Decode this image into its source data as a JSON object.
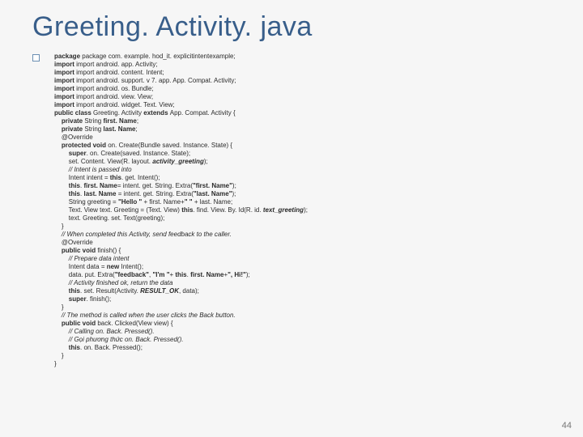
{
  "title": "Greeting. Activity. java",
  "page_number": "44",
  "code": {
    "l01": "package com. example. hod_it. explicitintentexample;",
    "l02": "import android. app. Activity;",
    "l03": "import android. content. Intent;",
    "l04": "import android. support. v 7. app. App. Compat. Activity;",
    "l05": "import android. os. Bundle;",
    "l06": "import android. view. View;",
    "l07": "import android. widget. Text. View;",
    "l08a": "public class ",
    "l08b": "Greeting. Activity ",
    "l08c": "extends ",
    "l08d": "App. Compat. Activity {",
    "l09a": "    private ",
    "l09b": "String ",
    "l09c": "first. Name",
    "l10a": "    private ",
    "l10b": "String ",
    "l10c": "last. Name",
    "l11": "    @Override",
    "l12a": "    protected void ",
    "l12b": "on. Create(Bundle saved. Instance. State) {",
    "l13a": "        super",
    "l13b": ". on. Create(saved. Instance. State);",
    "l14a": "        set. Content. View(R. layout. ",
    "l14b": "activity_greeting",
    "l14c": ");",
    "l15": "        // Intent is passed into",
    "l16a": "        Intent intent = ",
    "l16b": "this",
    "l16c": ". get. Intent();",
    "l17a": "        this",
    "l17b": ". ",
    "l17c": "first. Name",
    "l17d": "= intent. get. String. Extra(",
    "l17e": "\"first. Name\"",
    "l17f": ");",
    "l18a": "        this",
    "l18b": ". ",
    "l18c": "last. Name ",
    "l18d": "= intent. get. String. Extra(",
    "l18e": "\"last. Name\"",
    "l18f": ");",
    "l19a": "        String greeting = ",
    "l19b": "\"Hello \" ",
    "l19c": "+ first. Name+",
    "l19d": "\" \" ",
    "l19e": "+ last. Name;",
    "l20a": "        Text. View text. Greeting = (Text. View) ",
    "l20b": "this",
    "l20c": ". find. View. By. Id(R. id. ",
    "l20d": "text_greeting",
    "l20e": ");",
    "l21": "        text. Greeting. set. Text(greeting);",
    "l22": "    }",
    "l23": "    // When completed this Activity, send feedback to the caller.",
    "l24": "    @Override",
    "l25a": "    public void ",
    "l25b": "finish() {",
    "l26": "        // Prepare data intent",
    "l27a": "        Intent data = ",
    "l27b": "new ",
    "l27c": "Intent();",
    "l28a": "        data. put. Extra(",
    "l28b": "\"feedback\"",
    "l28c": ", ",
    "l28d": "\"I'm \"",
    "l28e": "+ ",
    "l28f": "this",
    "l28g": ". ",
    "l28h": "first. Name",
    "l28i": "+",
    "l28j": "\", Hi!\"",
    "l28k": ");",
    "l29": "        // Activity finished ok, return the data",
    "l30a": "        this",
    "l30b": ". set. Result(Activity. ",
    "l30c": "RESULT_OK",
    "l30d": ", data);",
    "l31a": "        super",
    "l31b": ". finish();",
    "l32": "    }",
    "l33": "    // The method is called when the user clicks the Back button.",
    "l34a": "    public void ",
    "l34b": "back. Clicked(View view) {",
    "l35": "        // Calling on. Back. Pressed().",
    "l36": "        // Gọi phương thức on. Back. Pressed().",
    "l37a": "        this",
    "l37b": ". on. Back. Pressed();",
    "l38": "    }",
    "l39": "}"
  }
}
